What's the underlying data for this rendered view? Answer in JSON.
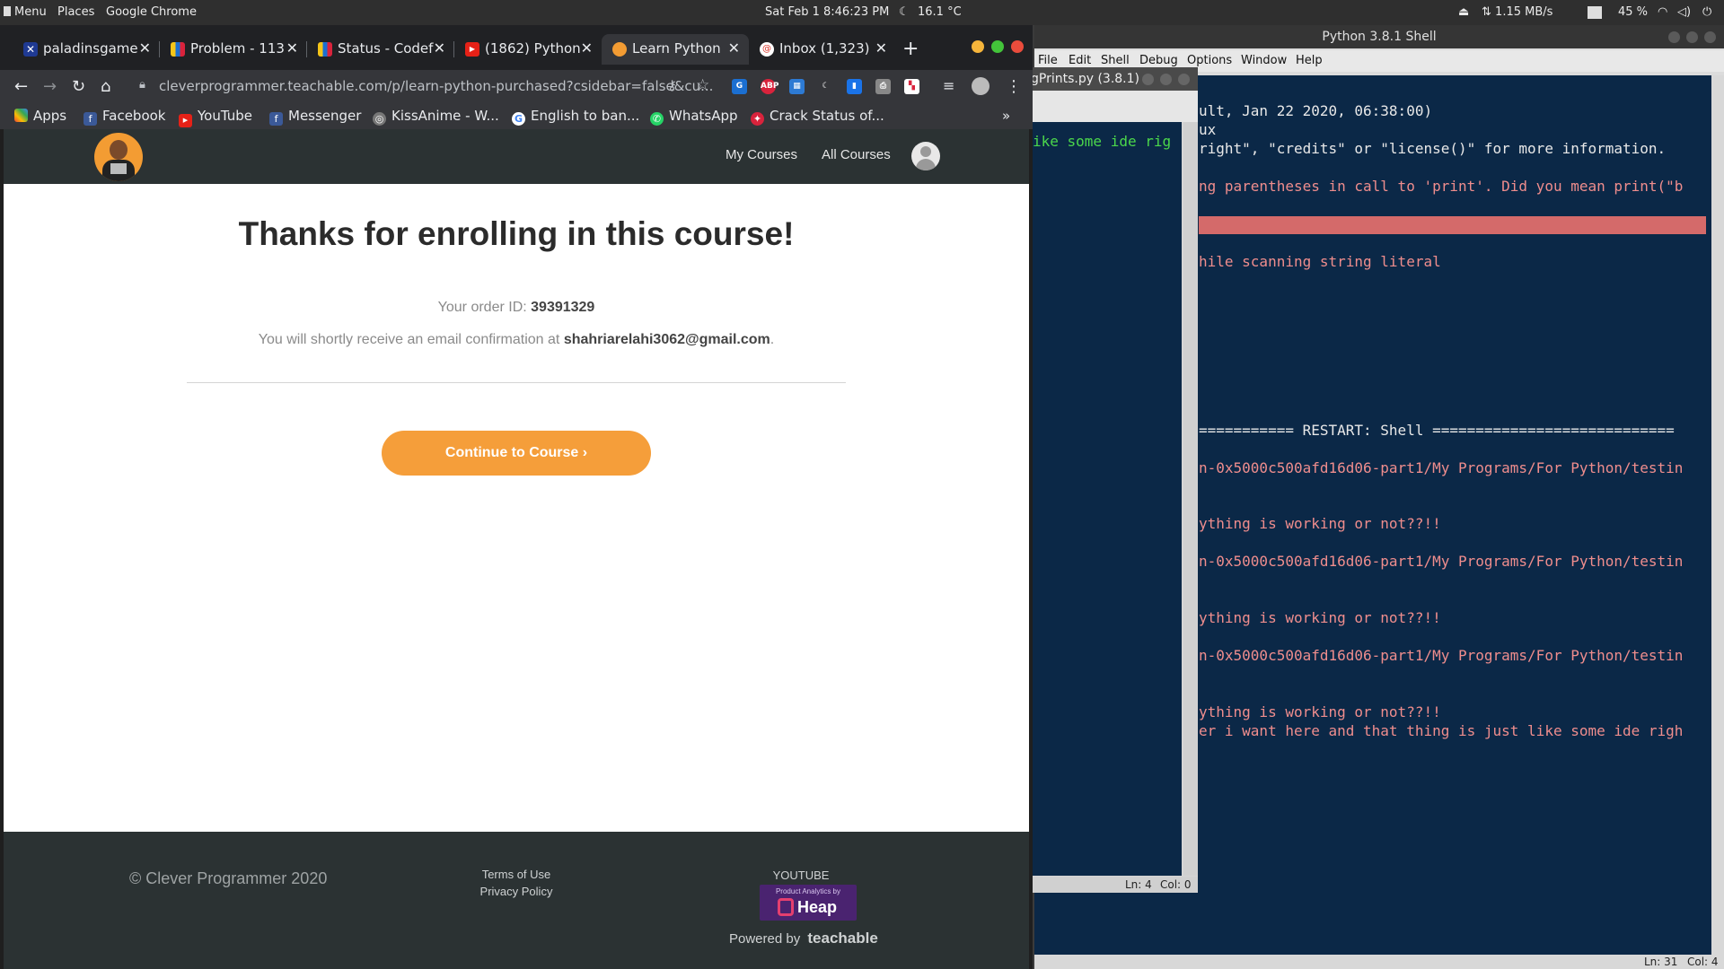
{
  "panel": {
    "menu": "Menu",
    "places": "Places",
    "app": "Google Chrome",
    "datetime": "Sat Feb 1   8:46:23 PM",
    "weather": "16.1 °C",
    "net_speed": "1.15 MB/s",
    "battery": "45 %"
  },
  "chrome": {
    "tabs": [
      {
        "label": "paladinsgame",
        "favicon": "paladins-icon",
        "color": "#1f3a93"
      },
      {
        "label": "Problem - 113",
        "favicon": "codeforces-icon",
        "color": "#1b6fd1"
      },
      {
        "label": "Status - Codef",
        "favicon": "codeforces-icon",
        "color": "#1b6fd1"
      },
      {
        "label": "(1862) Python",
        "favicon": "youtube-icon",
        "color": "#e62117"
      },
      {
        "label": "Learn Python",
        "favicon": "clever-programmer-icon",
        "color": "#f39c33"
      },
      {
        "label": "Inbox (1,323)",
        "favicon": "gmail-icon",
        "color": "#555"
      }
    ],
    "new_tab": "+",
    "url": "cleverprogrammer.teachable.com/p/learn-python-purchased?csidebar=false&cu...",
    "bookmarks": [
      {
        "label": "Apps",
        "icon": "apps-grid-icon",
        "color": "#4285f4"
      },
      {
        "label": "Facebook",
        "icon": "facebook-icon",
        "color": "#3b5998"
      },
      {
        "label": "YouTube",
        "icon": "youtube-icon",
        "color": "#e62117"
      },
      {
        "label": "Messenger",
        "icon": "facebook-icon",
        "color": "#3b5998"
      },
      {
        "label": "KissAnime - W...",
        "icon": "kissanime-icon",
        "color": "#888"
      },
      {
        "label": "English to ban...",
        "icon": "google-icon",
        "color": "#fff"
      },
      {
        "label": "WhatsApp",
        "icon": "whatsapp-icon",
        "color": "#25d366"
      },
      {
        "label": "Crack Status of...",
        "icon": "crack-icon",
        "color": "#d9233c"
      }
    ],
    "bookmarks_more": "»"
  },
  "site": {
    "nav": {
      "my_courses": "My Courses",
      "all_courses": "All Courses"
    },
    "heading": "Thanks for enrolling in this course!",
    "order_label": "Your order ID:",
    "order_id": "39391329",
    "email_prefix": "You will shortly receive an email confirmation at",
    "email": "shahriarelahi3062@gmail.com",
    "email_suffix": ".",
    "continue_label": "Continue to Course ›",
    "footer": {
      "copyright": "© Clever Programmer 2020",
      "terms": "Terms of Use",
      "privacy": "Privacy Policy",
      "youtube": "YOUTUBE",
      "heap_tag": "Product Analytics by",
      "heap_name": "Heap",
      "powered_by": "Powered by",
      "powered_brand": "teachable"
    }
  },
  "editor": {
    "title": "gPrints.py (3.8.1)",
    "line": "ike some ide rig",
    "status_ln": "Ln: 4",
    "status_col": "Col: 0"
  },
  "shell": {
    "title": "Python 3.8.1 Shell",
    "menus": [
      "File",
      "Edit",
      "Shell",
      "Debug",
      "Options",
      "Window",
      "Help"
    ],
    "lines": [
      "ult, Jan 22 2020, 06:38:00)",
      "ux",
      "right\", \"credits\" or \"license()\" for more information.",
      "ng parentheses in call to 'print'. Did you mean print(\"b",
      "hile scanning string literal",
      "=========== RESTART: Shell ============================",
      "n-0x5000c500afd16d06-part1/My Programs/For Python/testin",
      "ything is working or not??!!",
      "n-0x5000c500afd16d06-part1/My Programs/For Python/testin",
      "ything is working or not??!!",
      "n-0x5000c500afd16d06-part1/My Programs/For Python/testin",
      "ything is working or not??!!",
      "er i want here and that thing is just like some ide righ"
    ],
    "status_ln": "Ln: 31",
    "status_col": "Col: 4"
  }
}
